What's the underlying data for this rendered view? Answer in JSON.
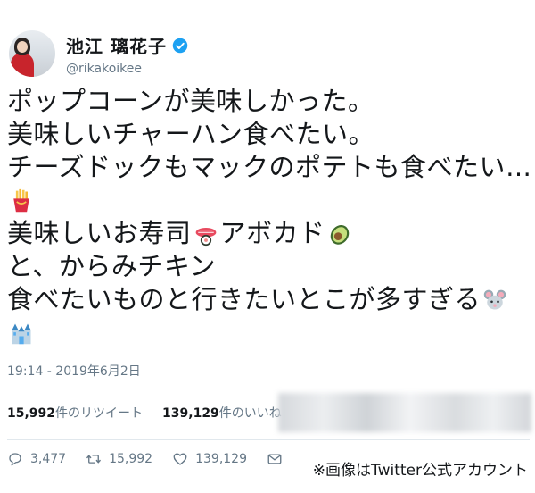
{
  "user": {
    "display_name": "池江 璃花子",
    "handle": "@rikakoikee",
    "verified": true
  },
  "tweet": {
    "line1": "ポップコーンが美味しかった。",
    "line2": "美味しいチャーハン食べたい。",
    "line3": "チーズドックもマックのポテトも食べたい…",
    "line4_emoji": "fries-icon",
    "line5_a": "美味しいお寿司",
    "line5_emoji_a": "sushi-icon",
    "line5_b": "アボカド",
    "line5_emoji_b": "avocado-icon",
    "line6": "と、からみチキン",
    "line7": "食べたいものと行きたいとこが多すぎる",
    "line7_emoji": "mouse-icon",
    "line8_emoji": "castle-icon"
  },
  "timestamp": "19:14 - 2019年6月2日",
  "stats": {
    "retweets_count": "15,992",
    "retweets_label": "件のリツイート",
    "likes_count": "139,129",
    "likes_label": "件のいいね"
  },
  "actions": {
    "reply_count": "3,477",
    "retweet_count": "15,992",
    "like_count": "139,129"
  },
  "credit": "※画像はTwitter公式アカウント",
  "colors": {
    "verified_blue": "#1da1f2",
    "secondary_text": "#657786"
  }
}
